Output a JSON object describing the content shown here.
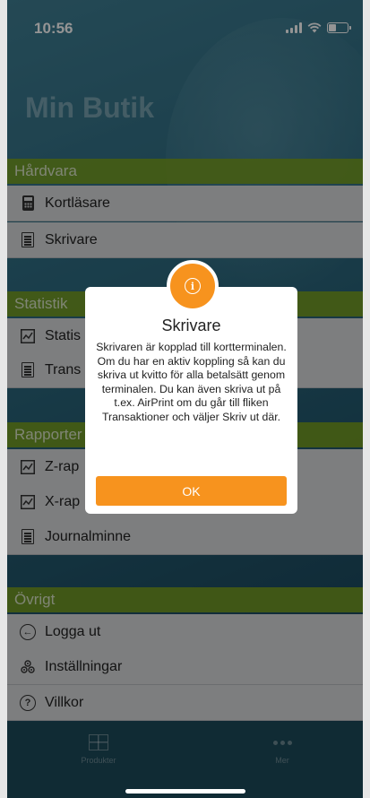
{
  "status_bar": {
    "time": "10:56"
  },
  "app": {
    "title": "Min Butik"
  },
  "sections": {
    "hardware": {
      "title": "Hårdvara",
      "items": [
        {
          "label": "Kortläsare",
          "icon": "card-reader-icon"
        },
        {
          "label": "Skrivare",
          "icon": "document-icon"
        }
      ]
    },
    "statistics": {
      "title": "Statistik",
      "items": [
        {
          "label": "Statis",
          "icon": "chart-icon"
        },
        {
          "label": "Trans",
          "icon": "document-icon"
        }
      ]
    },
    "reports": {
      "title": "Rapporter",
      "items": [
        {
          "label": "Z-rap",
          "icon": "chart-icon"
        },
        {
          "label": "X-rap",
          "icon": "chart-icon"
        },
        {
          "label": "Journalminne",
          "icon": "document-icon"
        }
      ]
    },
    "other": {
      "title": "Övrigt",
      "items": [
        {
          "label": "Logga ut",
          "icon": "arrow-left-circle-icon"
        },
        {
          "label": "Inställningar",
          "icon": "settings-icon"
        },
        {
          "label": "Villkor",
          "icon": "question-circle-icon"
        }
      ]
    }
  },
  "tab_bar": {
    "tabs": [
      {
        "label": "Produkter",
        "icon": "grid-icon"
      },
      {
        "label": "Mer",
        "icon": "more-dots-icon"
      }
    ]
  },
  "dialog": {
    "title": "Skrivare",
    "message": "Skrivaren är kopplad till kortterminalen. Om du har en aktiv koppling så kan du skriva ut kvitto för alla betalsätt genom terminalen. Du kan även skriva ut på t.ex. AirPrint om du går till fliken Transaktioner och väljer Skriv ut där.",
    "ok_label": "OK",
    "icon": "info-icon"
  },
  "colors": {
    "accent": "#f7931e",
    "section_header": "#7aa01e",
    "menu_item_bg": "#d7d9db"
  }
}
